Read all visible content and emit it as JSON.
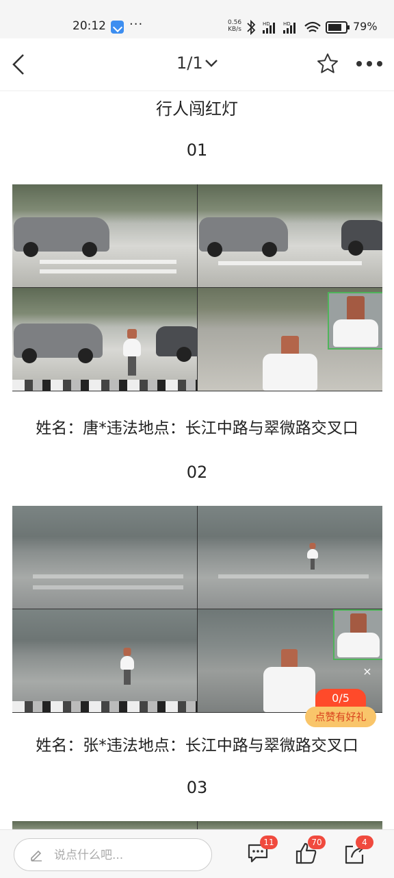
{
  "status_bar": {
    "time": "20:12",
    "network_speed_value": "0.56",
    "network_speed_unit": "KB/s",
    "battery": "79%"
  },
  "nav": {
    "page_indicator": "1/1",
    "icons": [
      "back-arrow-icon",
      "chevron-down-icon",
      "star-icon",
      "more-icon"
    ]
  },
  "article": {
    "title": "行人闯红灯",
    "entries": [
      {
        "number": "01",
        "caption": "姓名：唐*违法地点：长江中路与翠微路交叉口"
      },
      {
        "number": "02",
        "caption": "姓名：张*违法地点：长江中路与翠微路交叉口"
      },
      {
        "number": "03",
        "caption": ""
      }
    ]
  },
  "like_widget": {
    "progress": "0/5",
    "label": "点赞有好礼",
    "close": "×"
  },
  "bottom_bar": {
    "comment_placeholder": "说点什么吧...",
    "comments_count": "11",
    "likes_count": "70",
    "shares_count": "4"
  },
  "colors": {
    "accent_red": "#ff4a2a",
    "badge_red": "#f04a3e",
    "promo_orange": "#f9c56a"
  }
}
